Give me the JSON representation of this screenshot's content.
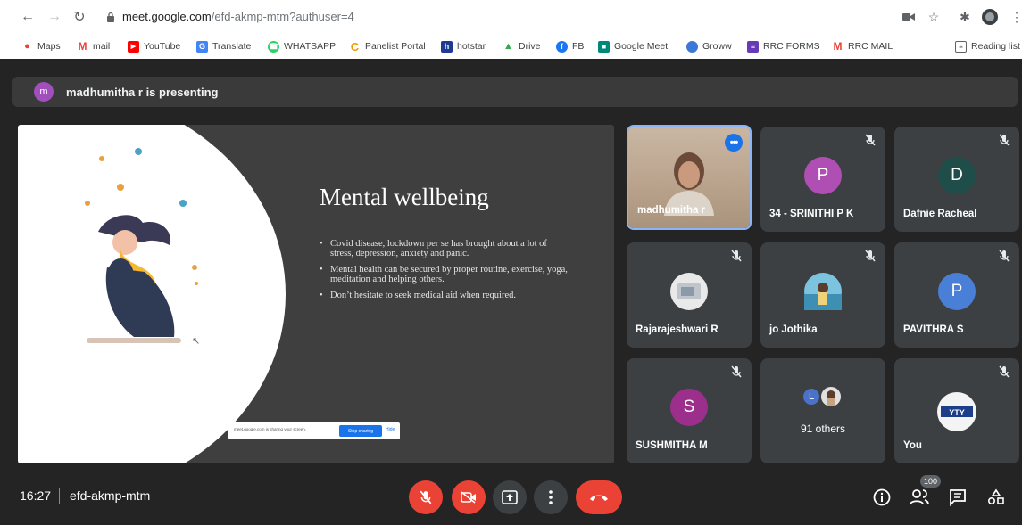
{
  "browser": {
    "url_host": "meet.google.com",
    "url_path": "/efd-akmp-mtm?authuser=4",
    "bookmarks": [
      {
        "label": "Maps",
        "color": "#ea4335",
        "glyph": "▼"
      },
      {
        "label": "mail",
        "color": "#ea4335",
        "glyph": "M"
      },
      {
        "label": "YouTube",
        "color": "#ff0000",
        "glyph": "▶"
      },
      {
        "label": "Translate",
        "color": "#4285f4",
        "glyph": "G"
      },
      {
        "label": "WHATSAPP",
        "color": "#25d366",
        "glyph": "☎"
      },
      {
        "label": "Panelist Portal",
        "color": "#f29900",
        "glyph": "C"
      },
      {
        "label": "hotstar",
        "color": "#1f3a93",
        "glyph": "h"
      },
      {
        "label": "Drive",
        "color": "#34a853",
        "glyph": "▲"
      },
      {
        "label": "FB",
        "color": "#1877f2",
        "glyph": "f"
      },
      {
        "label": "Google Meet",
        "color": "#00897b",
        "glyph": "■"
      },
      {
        "label": "Groww",
        "color": "#3c78d8",
        "glyph": "●"
      },
      {
        "label": "RRC FORMS",
        "color": "#673ab7",
        "glyph": "≡"
      },
      {
        "label": "RRC MAIL",
        "color": "#ea4335",
        "glyph": "M"
      }
    ],
    "reading_list": "Reading list"
  },
  "meet": {
    "presenting_avatar": "m",
    "presenting_text": "madhumitha r is presenting",
    "slide": {
      "title": "Mental wellbeing",
      "bullets": [
        "Covid disease, lockdown per se has brought about a lot of stress, depression, anxiety and panic.",
        "Mental health can be secured by proper routine, exercise, yoga, meditation and helping others.",
        "Don’t hesitate to seek medical aid when required."
      ],
      "share_text": "meet.google.com is sharing your screen.",
      "stop_sharing": "Stop sharing",
      "hide": "Hide"
    },
    "participants": [
      {
        "name": "madhumitha r",
        "type": "video",
        "more": "•••"
      },
      {
        "name": "34 - SRINITHI P K",
        "type": "avatar",
        "letter": "P",
        "color": "#b04fb3"
      },
      {
        "name": "Dafnie Racheal",
        "type": "avatar",
        "letter": "D",
        "color": "#1f4e4a"
      },
      {
        "name": "Rajarajeshwari R",
        "type": "photo",
        "color": "#d9d9d9"
      },
      {
        "name": "jo Jothika",
        "type": "photo",
        "color": "#4aa3c7"
      },
      {
        "name": "PAVITHRA S",
        "type": "avatar",
        "letter": "P",
        "color": "#4a7fd8"
      },
      {
        "name": "SUSHMITHA M",
        "type": "avatar",
        "letter": "S",
        "color": "#9c2f8c"
      },
      {
        "name": "91 others",
        "type": "others",
        "letter": "L",
        "color": "#4a72c9"
      },
      {
        "name": "You",
        "type": "photo",
        "color": "#1d3f8a"
      }
    ],
    "time": "16:27",
    "meeting_code": "efd-akmp-mtm",
    "people_count": "100"
  }
}
